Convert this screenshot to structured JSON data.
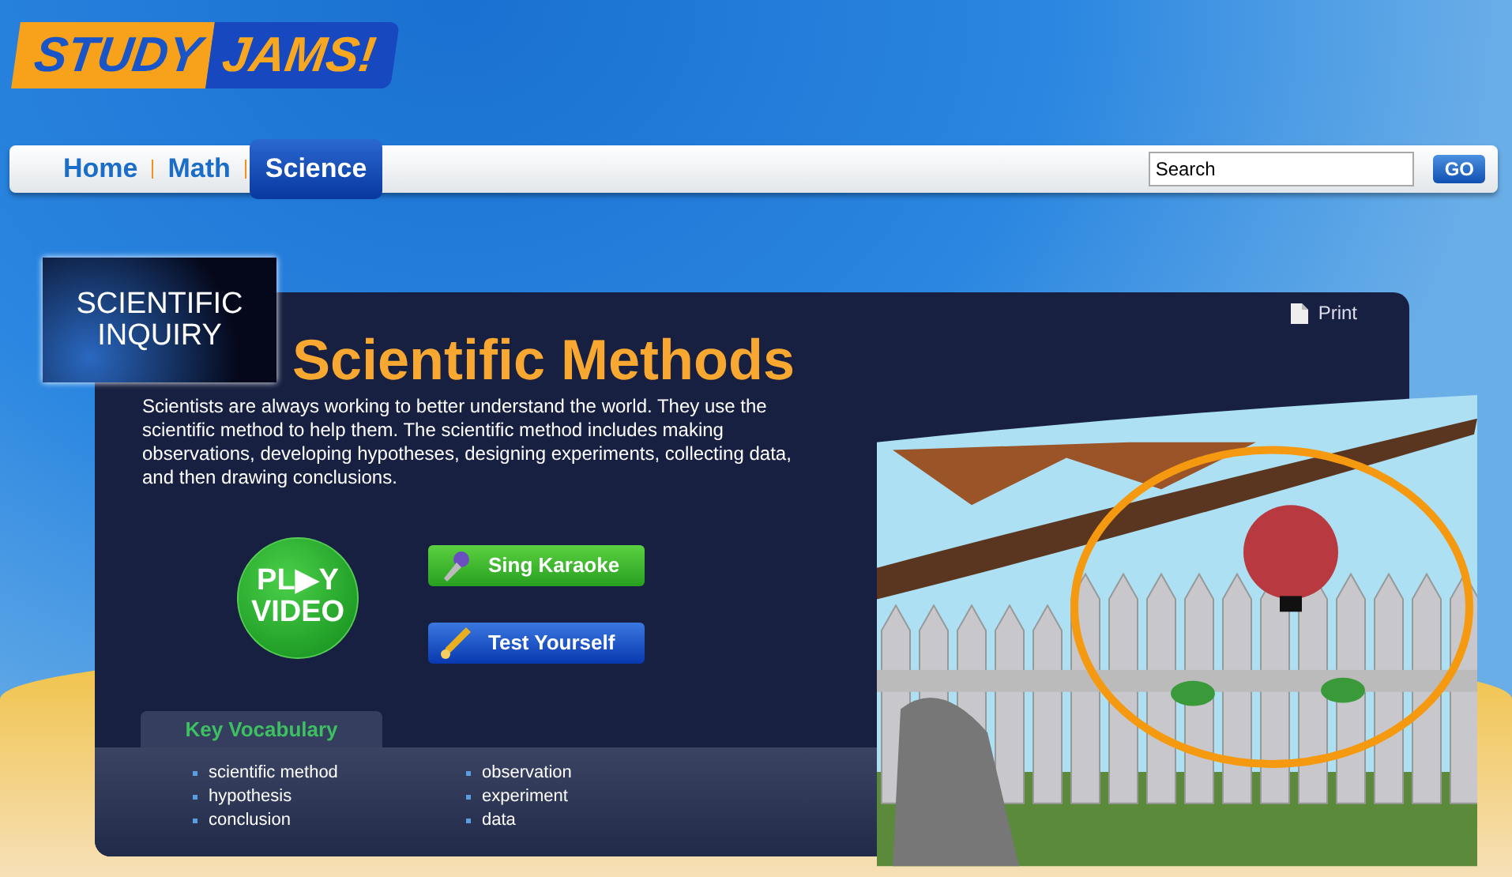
{
  "logo": {
    "word_1": "STUDY",
    "word_2": "JAMS!"
  },
  "nav": {
    "tabs": [
      {
        "label": "Home",
        "selected": false
      },
      {
        "label": "Math",
        "selected": false
      },
      {
        "label": "Science",
        "selected": true
      }
    ],
    "search": {
      "value": "Search"
    },
    "go_button": "GO"
  },
  "lesson": {
    "category_badge": "SCIENTIFIC INQUIRY",
    "print_link": "Print",
    "title": "Scientific Methods",
    "description": "Scientists are always working to better understand the world. They use the scientific method to help them. The scientific method includes making observations, developing hypotheses, designing experiments, collecting data, and then drawing conclusions.",
    "play_video": {
      "line_1": "PL▶Y",
      "line_2": "VIDEO"
    },
    "buttons": [
      {
        "kind": "karaoke",
        "label": "Sing Karaoke"
      },
      {
        "kind": "quiz",
        "label": "Test Yourself"
      }
    ],
    "vocabulary": {
      "heading": "Key Vocabulary",
      "columns": [
        [
          "scientific method",
          "hypothesis",
          "conclusion"
        ],
        [
          "observation",
          "experiment",
          "data"
        ]
      ]
    }
  }
}
